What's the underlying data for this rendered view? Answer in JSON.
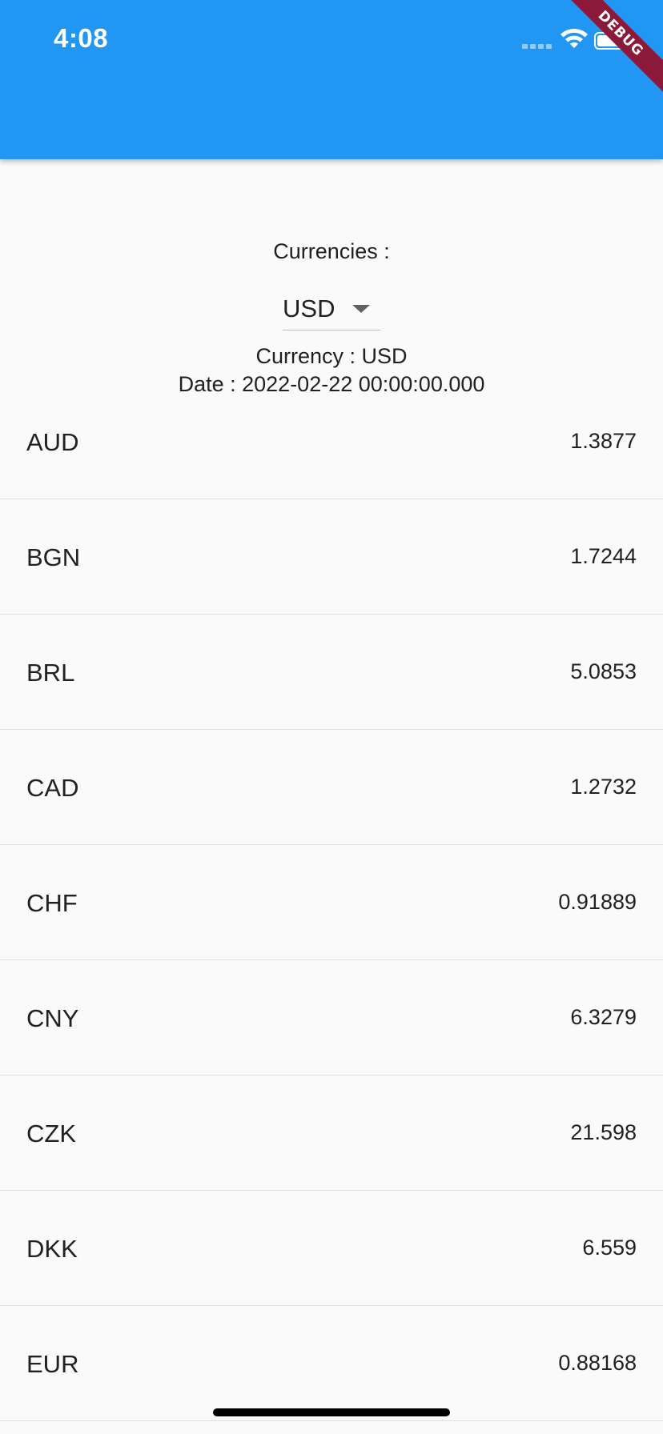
{
  "status_bar": {
    "time": "4:08"
  },
  "debug_banner": "DEBUG",
  "selector": {
    "label": "Currencies :",
    "selected": "USD"
  },
  "info": {
    "currency_line": "Currency : USD",
    "date_line": "Date : 2022-02-22 00:00:00.000"
  },
  "rates": [
    {
      "code": "AUD",
      "rate": "1.3877"
    },
    {
      "code": "BGN",
      "rate": "1.7244"
    },
    {
      "code": "BRL",
      "rate": "5.0853"
    },
    {
      "code": "CAD",
      "rate": "1.2732"
    },
    {
      "code": "CHF",
      "rate": "0.91889"
    },
    {
      "code": "CNY",
      "rate": "6.3279"
    },
    {
      "code": "CZK",
      "rate": "21.598"
    },
    {
      "code": "DKK",
      "rate": "6.559"
    },
    {
      "code": "EUR",
      "rate": "0.88168"
    }
  ],
  "colors": {
    "appbar": "#2196F3",
    "banner": "#8B1A3A"
  },
  "icons": [
    "wifi-icon",
    "battery-icon",
    "signal-icon",
    "dropdown-arrow-icon"
  ]
}
